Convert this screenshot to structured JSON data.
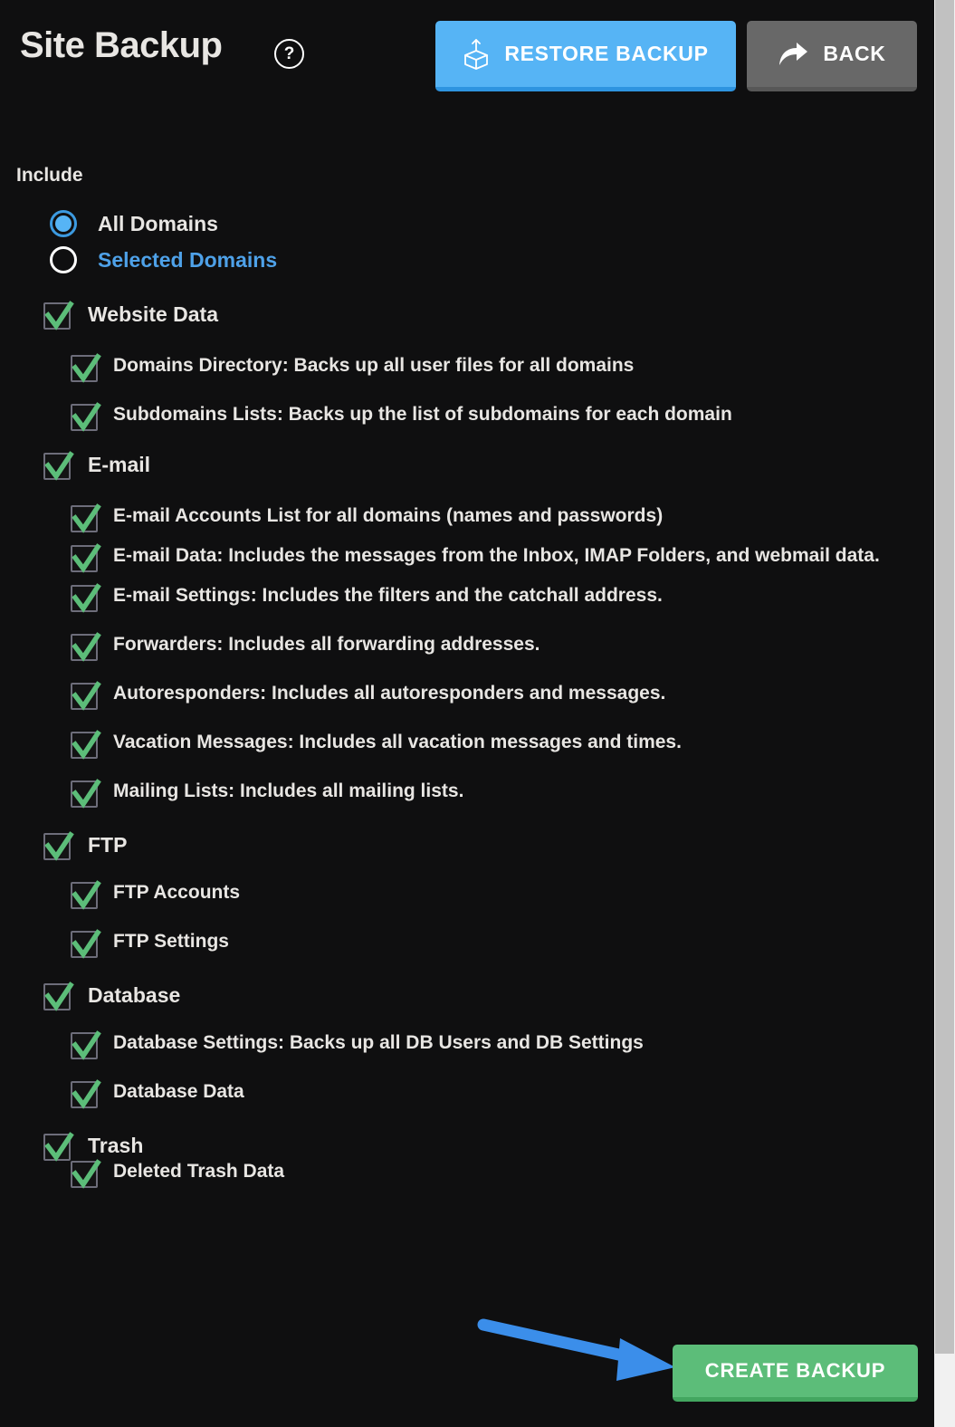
{
  "header": {
    "title": "Site Backup",
    "help_icon": "question-mark-circle-icon",
    "help_glyph": "?",
    "restore_button": {
      "label": "RESTORE BACKUP",
      "icon": "package-upload-icon"
    },
    "back_button": {
      "label": "BACK",
      "icon": "forward-arrow-icon"
    }
  },
  "include": {
    "label": "Include",
    "radios": [
      {
        "label": "All Domains",
        "selected": true
      },
      {
        "label": "Selected Domains",
        "selected": false
      }
    ]
  },
  "tree": [
    {
      "level": 1,
      "label": "Website Data",
      "checked": true
    },
    {
      "level": 2,
      "label": "Domains Directory: Backs up all user files for all domains",
      "checked": true
    },
    {
      "level": 2,
      "label": "Subdomains Lists: Backs up the list of subdomains for each domain",
      "checked": true
    },
    {
      "level": 1,
      "label": "E-mail",
      "checked": true
    },
    {
      "level": 2,
      "label": "E-mail Accounts List for all domains (names and passwords)",
      "checked": true
    },
    {
      "level": 2,
      "label": "E-mail Data: Includes the messages from the Inbox, IMAP Folders, and webmail data.",
      "checked": true
    },
    {
      "level": 2,
      "label": "E-mail Settings: Includes the filters and the catchall address.",
      "checked": true
    },
    {
      "level": 2,
      "label": "Forwarders: Includes all forwarding addresses.",
      "checked": true
    },
    {
      "level": 2,
      "label": "Autoresponders: Includes all autoresponders and messages.",
      "checked": true
    },
    {
      "level": 2,
      "label": "Vacation Messages: Includes all vacation messages and times.",
      "checked": true
    },
    {
      "level": 2,
      "label": "Mailing Lists: Includes all mailing lists.",
      "checked": true
    },
    {
      "level": 1,
      "label": "FTP",
      "checked": true
    },
    {
      "level": 2,
      "label": "FTP Accounts",
      "checked": true
    },
    {
      "level": 2,
      "label": "FTP Settings",
      "checked": true
    },
    {
      "level": 1,
      "label": "Database",
      "checked": true
    },
    {
      "level": 2,
      "label": "Database Settings: Backs up all DB Users and DB Settings",
      "checked": true
    },
    {
      "level": 2,
      "label": "Database Data",
      "checked": true
    },
    {
      "level": 1,
      "label": "Trash",
      "checked": true
    },
    {
      "level": 2,
      "label": "Deleted Trash Data",
      "checked": true
    }
  ],
  "footer": {
    "create_backup_label": "CREATE BACKUP"
  },
  "annotation": {
    "arrow": "blue-pointer-arrow"
  },
  "colors": {
    "background": "#0f0f10",
    "text": "#e8e6e3",
    "accent_blue": "#56b4f5",
    "link_blue": "#4ea1e8",
    "check_green": "#5cbd79",
    "button_green": "#5cbd79",
    "button_gray": "#686868",
    "checkbox_border": "#6d6d7a",
    "annotation_blue": "#3b8eea",
    "scrollbar_thumb": "#c1c1c1",
    "scrollbar_track": "#f1f1f1"
  }
}
